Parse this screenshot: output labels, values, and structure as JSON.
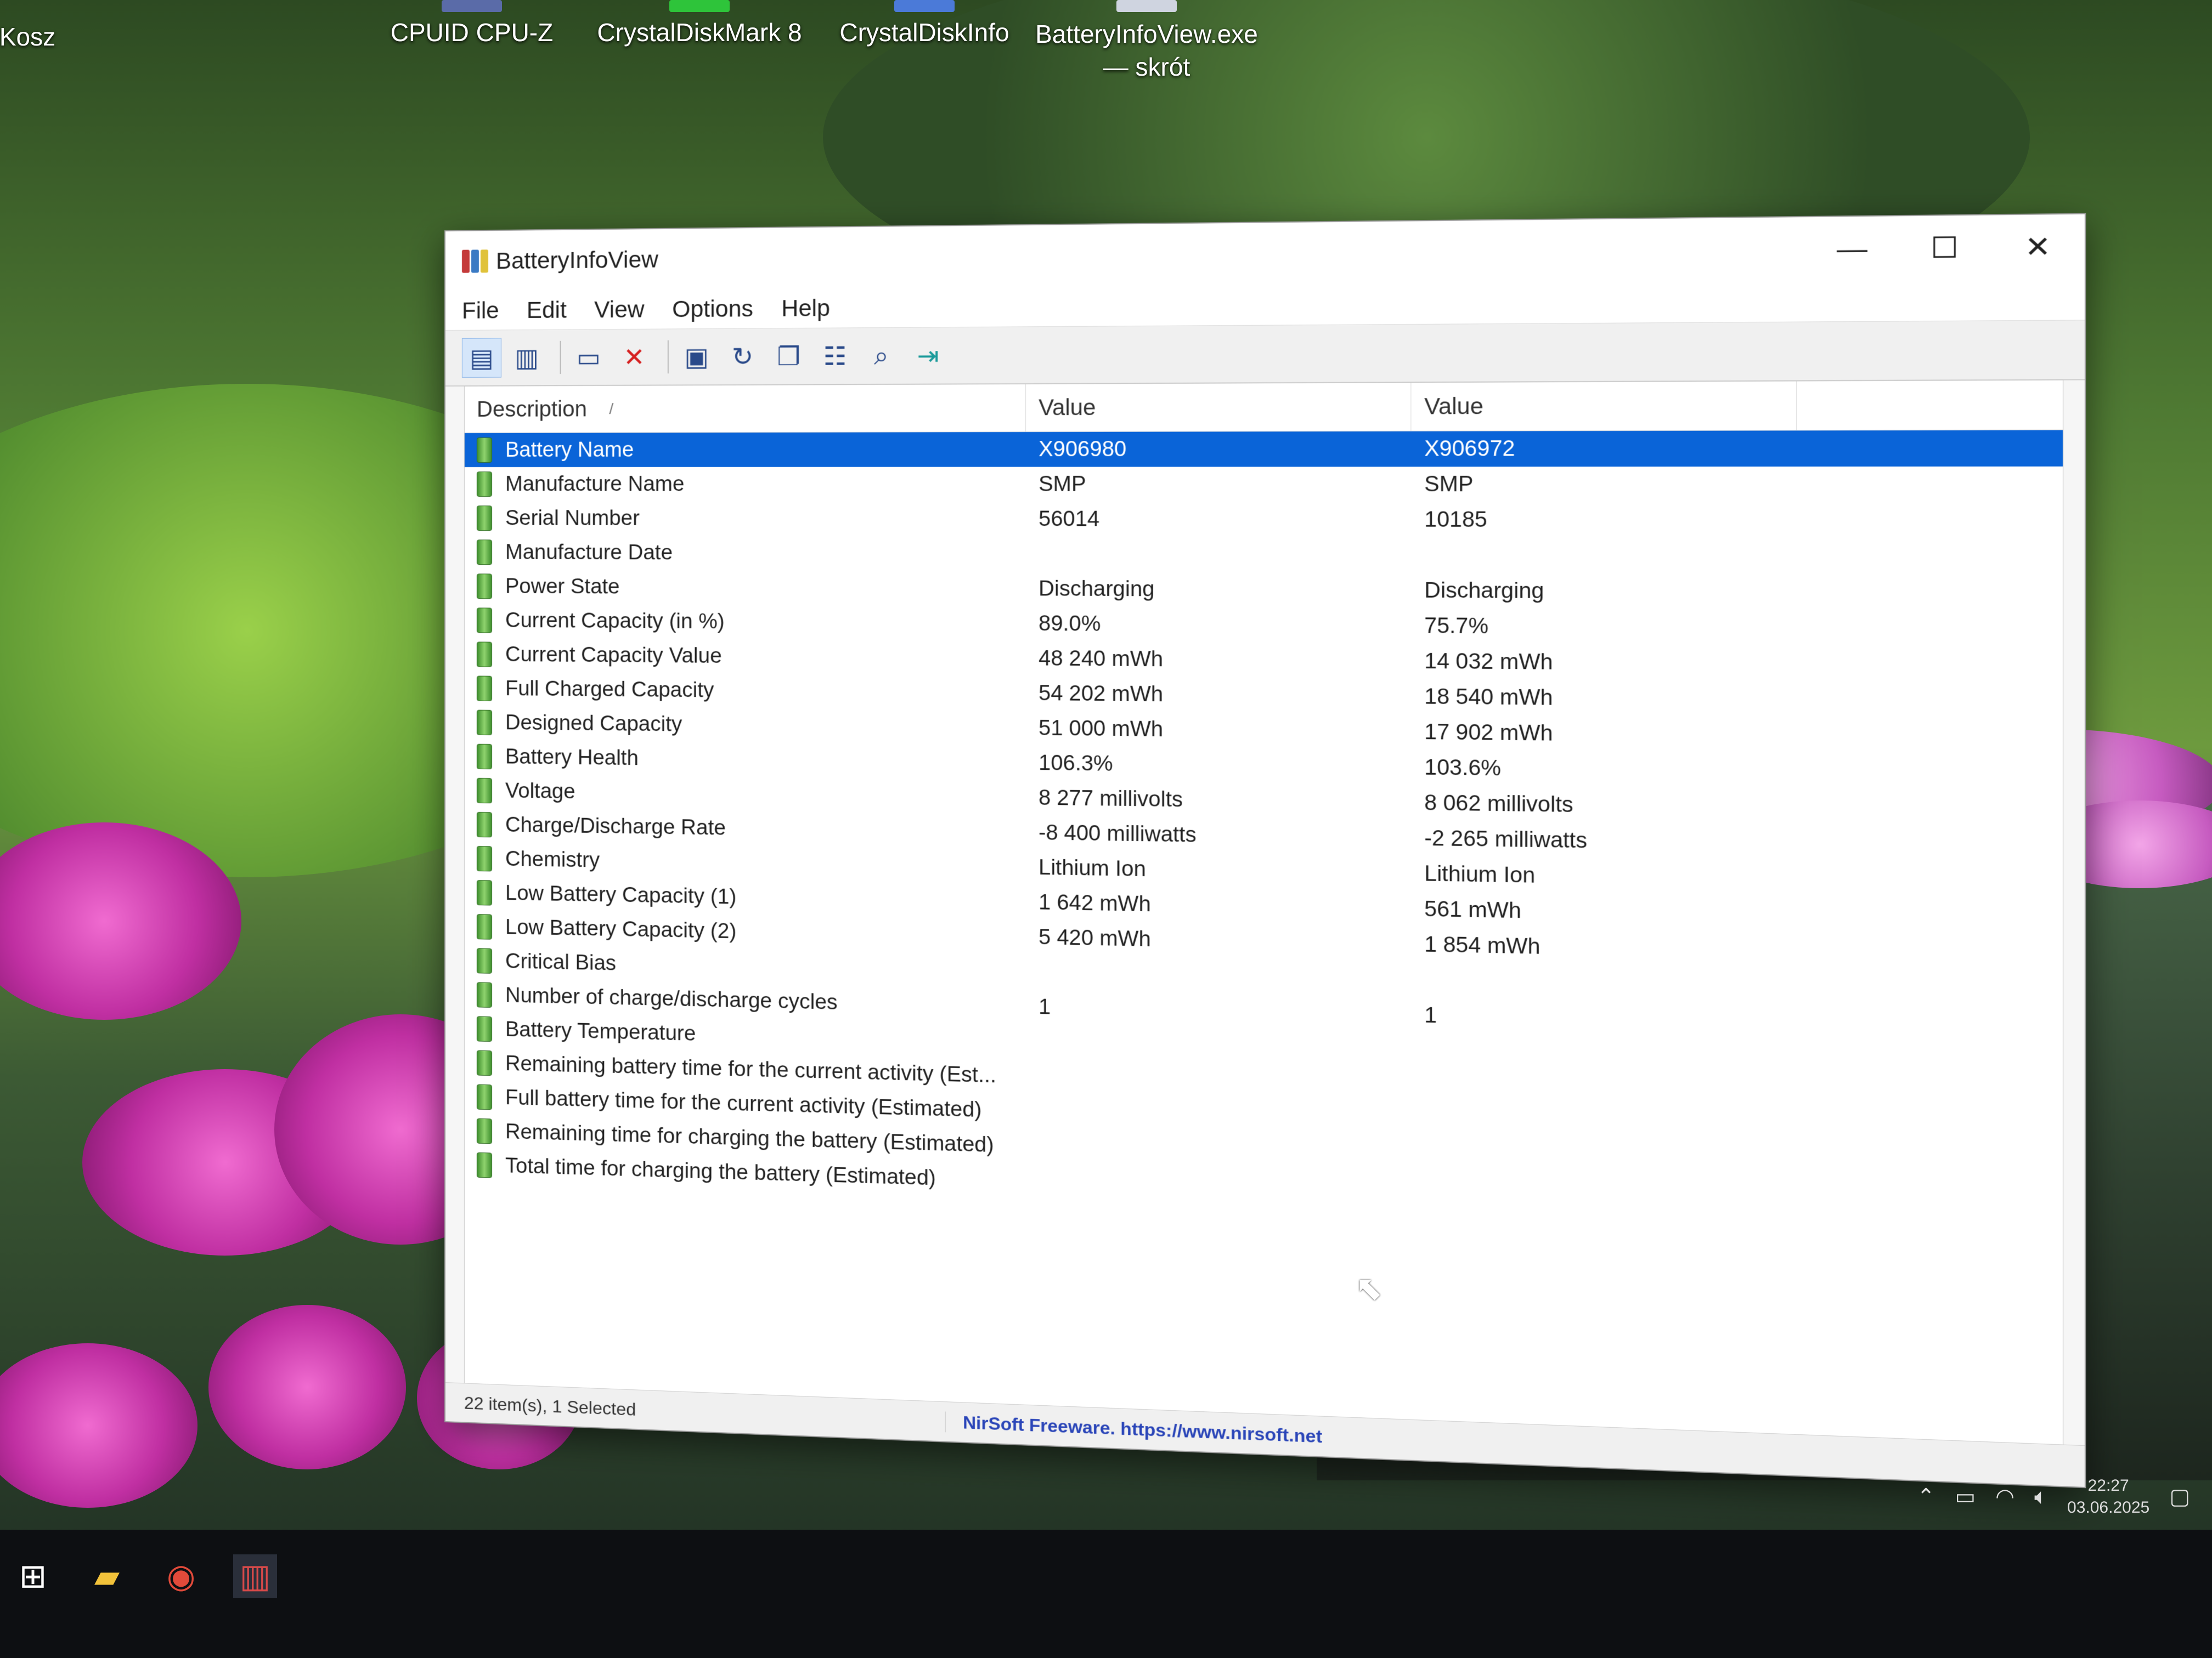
{
  "desktop": {
    "icons": [
      {
        "label": "Kosz",
        "icon": "recycle-bin-icon"
      },
      {
        "label": "CPUID CPU-Z",
        "icon": "cpuz-icon"
      },
      {
        "label": "CrystalDiskMark 8",
        "icon": "crystaldiskmark-icon"
      },
      {
        "label": "CrystalDiskInfo",
        "icon": "crystaldiskinfo-icon"
      },
      {
        "label": "BatteryInfoView.exe — skrót",
        "icon": "batteryinfoview-shortcut-icon"
      }
    ]
  },
  "window": {
    "title": "BatteryInfoView",
    "controls": {
      "minimize": "—",
      "maximize": "☐",
      "close": "✕"
    },
    "menu": [
      "File",
      "Edit",
      "View",
      "Options",
      "Help"
    ],
    "toolbar_icons": [
      "html-report-icon",
      "copy-list-icon",
      "window-icon",
      "delete-icon",
      "save-icon",
      "refresh-icon",
      "copy-icon",
      "properties-icon",
      "find-icon",
      "exit-icon"
    ],
    "columns": [
      "Description",
      "Value",
      "Value"
    ],
    "sort_indicator": "/",
    "rows": [
      {
        "desc": "Battery Name",
        "v1": "X906980",
        "v2": "X906972",
        "selected": true
      },
      {
        "desc": "Manufacture Name",
        "v1": "SMP",
        "v2": "SMP"
      },
      {
        "desc": "Serial Number",
        "v1": "56014",
        "v2": "10185"
      },
      {
        "desc": "Manufacture Date",
        "v1": "",
        "v2": ""
      },
      {
        "desc": "Power State",
        "v1": "Discharging",
        "v2": "Discharging"
      },
      {
        "desc": "Current Capacity (in %)",
        "v1": "89.0%",
        "v2": "75.7%"
      },
      {
        "desc": "Current Capacity Value",
        "v1": "48 240 mWh",
        "v2": "14 032 mWh"
      },
      {
        "desc": "Full Charged Capacity",
        "v1": "54 202 mWh",
        "v2": "18 540 mWh"
      },
      {
        "desc": "Designed Capacity",
        "v1": "51 000 mWh",
        "v2": "17 902 mWh"
      },
      {
        "desc": "Battery Health",
        "v1": "106.3%",
        "v2": "103.6%"
      },
      {
        "desc": "Voltage",
        "v1": "8 277 millivolts",
        "v2": "8 062 millivolts"
      },
      {
        "desc": "Charge/Discharge Rate",
        "v1": "-8 400 milliwatts",
        "v2": "-2 265 milliwatts"
      },
      {
        "desc": "Chemistry",
        "v1": "Lithium Ion",
        "v2": "Lithium Ion"
      },
      {
        "desc": "Low Battery Capacity (1)",
        "v1": "1 642 mWh",
        "v2": "561 mWh"
      },
      {
        "desc": "Low Battery Capacity (2)",
        "v1": "5 420 mWh",
        "v2": "1 854 mWh"
      },
      {
        "desc": "Critical Bias",
        "v1": "",
        "v2": ""
      },
      {
        "desc": "Number of charge/discharge cycles",
        "v1": "1",
        "v2": "1"
      },
      {
        "desc": "Battery Temperature",
        "v1": "",
        "v2": ""
      },
      {
        "desc": "Remaining battery time for the current activity (Est...",
        "v1": "",
        "v2": ""
      },
      {
        "desc": "Full battery time for the current activity (Estimated)",
        "v1": "",
        "v2": ""
      },
      {
        "desc": "Remaining time for charging the battery (Estimated)",
        "v1": "",
        "v2": ""
      },
      {
        "desc": "Total  time for charging the battery (Estimated)",
        "v1": "",
        "v2": ""
      }
    ],
    "status": {
      "count": "22 item(s), 1 Selected",
      "link": "NirSoft Freeware. https://www.nirsoft.net"
    }
  },
  "taskbar": {
    "items": [
      "start-icon",
      "file-explorer-icon",
      "chrome-icon",
      "batteryinfoview-taskbar-icon"
    ],
    "tray_icons": [
      "chevron-up-icon",
      "battery-icon",
      "wifi-icon",
      "volume-icon",
      "notification-icon"
    ],
    "time": "22:27",
    "date": "03.06.2025"
  },
  "colors": {
    "selection": "#0a64d8",
    "battery_icon": "#5cb23e",
    "link": "#2a45b8"
  }
}
